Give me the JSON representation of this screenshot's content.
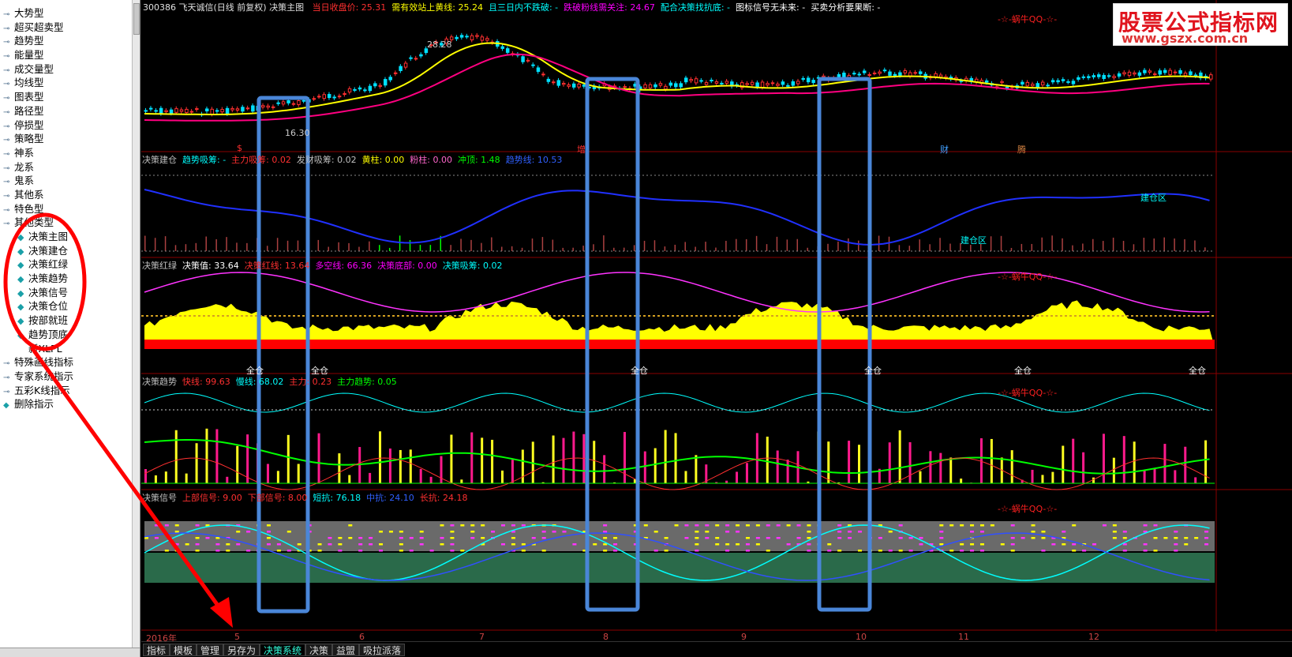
{
  "tree": {
    "items": [
      {
        "label": "大势型",
        "level": 0
      },
      {
        "label": "超买超卖型",
        "level": 0
      },
      {
        "label": "趋势型",
        "level": 0
      },
      {
        "label": "能量型",
        "level": 0
      },
      {
        "label": "成交量型",
        "level": 0
      },
      {
        "label": "均线型",
        "level": 0
      },
      {
        "label": "图表型",
        "level": 0
      },
      {
        "label": "路径型",
        "level": 0
      },
      {
        "label": "停损型",
        "level": 0
      },
      {
        "label": "策略型",
        "level": 0
      },
      {
        "label": "神系",
        "level": 0
      },
      {
        "label": "龙系",
        "level": 0
      },
      {
        "label": "鬼系",
        "level": 0
      },
      {
        "label": "其他系",
        "level": 0
      },
      {
        "label": "特色型",
        "level": 0
      },
      {
        "label": "其他类型",
        "level": 0
      },
      {
        "label": "决策主图",
        "level": 1
      },
      {
        "label": "决策建仓",
        "level": 1
      },
      {
        "label": "决策红绿",
        "level": 1
      },
      {
        "label": "决策趋势",
        "level": 1
      },
      {
        "label": "决策信号",
        "level": 1
      },
      {
        "label": "决策仓位",
        "level": 1
      },
      {
        "label": "按部就班",
        "level": 1
      },
      {
        "label": "趋势顶底",
        "level": 1
      },
      {
        "label": "新XLPL",
        "level": 1,
        "noicon": true
      },
      {
        "label": "特殊画线指标",
        "level": 0
      },
      {
        "label": "专家系统指示",
        "level": 0
      },
      {
        "label": "五彩K线指示",
        "level": 0
      },
      {
        "label": "删除指示",
        "level": 0,
        "diamond": true
      }
    ]
  },
  "header": {
    "stock": "300386 飞天诚信(日线 前复权) 决策主图",
    "items": [
      {
        "text": "当日收盘价: 25.31",
        "color": "#ff3030"
      },
      {
        "text": "需有效站上黄线: 25.24",
        "color": "#ffff00"
      },
      {
        "text": "且三日内不跌破: -",
        "color": "#00ffff"
      },
      {
        "text": "跌破粉线需关注: 24.67",
        "color": "#ff00ff"
      },
      {
        "text": "配合决策找抗底: -",
        "color": "#00ffff"
      },
      {
        "text": "图标信号无未来: -",
        "color": "#ffffff"
      },
      {
        "text": "买卖分析要果断: -",
        "color": "#ffffff"
      }
    ]
  },
  "logo": {
    "main": "股票公式指标网",
    "url": "www.gszx.com.cn"
  },
  "main_chart": {
    "price_high": "28.28",
    "price_low": "16.30",
    "watermark": "-☆-蜗牛QQ-☆-",
    "labels": [
      "增",
      "财",
      "腾",
      "$"
    ]
  },
  "panels": [
    {
      "name": "决策建仓",
      "items": [
        {
          "text": "决策建仓",
          "color": "#c0c0c0"
        },
        {
          "text": "趋势吸筹: -",
          "color": "#00ffff"
        },
        {
          "text": "主力吸筹: 0.02",
          "color": "#ff3030"
        },
        {
          "text": "发财吸筹: 0.02",
          "color": "#c0c0c0"
        },
        {
          "text": "黄柱: 0.00",
          "color": "#ffff00"
        },
        {
          "text": "粉柱: 0.00",
          "color": "#ff66cc"
        },
        {
          "text": "冲顶: 1.48",
          "color": "#00ff00"
        },
        {
          "text": "趋势线: 10.53",
          "color": "#3060ff"
        }
      ],
      "annotations": [
        "建仓区",
        "建仓区"
      ]
    },
    {
      "name": "决策红绿",
      "items": [
        {
          "text": "决策红绿",
          "color": "#c0c0c0"
        },
        {
          "text": "决策值: 33.64",
          "color": "#ffffff"
        },
        {
          "text": "决策红线: 13.64",
          "color": "#ff3030"
        },
        {
          "text": "多空线: 66.36",
          "color": "#ff00ff"
        },
        {
          "text": "决策底部: 0.00",
          "color": "#ff00ff"
        },
        {
          "text": "决策吸筹: 0.02",
          "color": "#00ffff"
        }
      ],
      "annotations": [
        "全仓",
        "全仓",
        "全仓",
        "全仓",
        "全仓",
        "全仓"
      ]
    },
    {
      "name": "决策趋势",
      "items": [
        {
          "text": "决策趋势",
          "color": "#c0c0c0"
        },
        {
          "text": "快线: 99.63",
          "color": "#ff3030"
        },
        {
          "text": "慢线: 68.02",
          "color": "#00ffff"
        },
        {
          "text": "主力: 0.23",
          "color": "#ff3030"
        },
        {
          "text": "主力趋势: 0.05",
          "color": "#00ff00"
        }
      ]
    },
    {
      "name": "决策信号",
      "items": [
        {
          "text": "决策信号",
          "color": "#c0c0c0"
        },
        {
          "text": "上部信号: 9.00",
          "color": "#ff3030"
        },
        {
          "text": "下部信号: 8.00",
          "color": "#ff3030"
        },
        {
          "text": "短抗: 76.18",
          "color": "#00ffff"
        },
        {
          "text": "中抗: 24.10",
          "color": "#3060ff"
        },
        {
          "text": "长抗: 24.18",
          "color": "#ff3030"
        }
      ]
    }
  ],
  "xaxis": {
    "labels": [
      "2016年",
      "5",
      "6",
      "7",
      "8",
      "9",
      "10",
      "11",
      "12"
    ]
  },
  "bottom_tabs": [
    {
      "label": "指标",
      "active": false
    },
    {
      "label": "模板",
      "active": false
    },
    {
      "label": "管理",
      "active": false
    },
    {
      "label": "另存为",
      "active": false
    },
    {
      "label": "决策系统",
      "active": true
    },
    {
      "label": "决策",
      "active": false
    },
    {
      "label": "益盟",
      "active": false
    },
    {
      "label": "吸拉派落",
      "active": false
    }
  ],
  "colors": {
    "accent_red": "#ff0000",
    "highlight_blue": "#4a86d8",
    "ma_yellow": "#ffff00",
    "ma_pink": "#ff0080"
  }
}
